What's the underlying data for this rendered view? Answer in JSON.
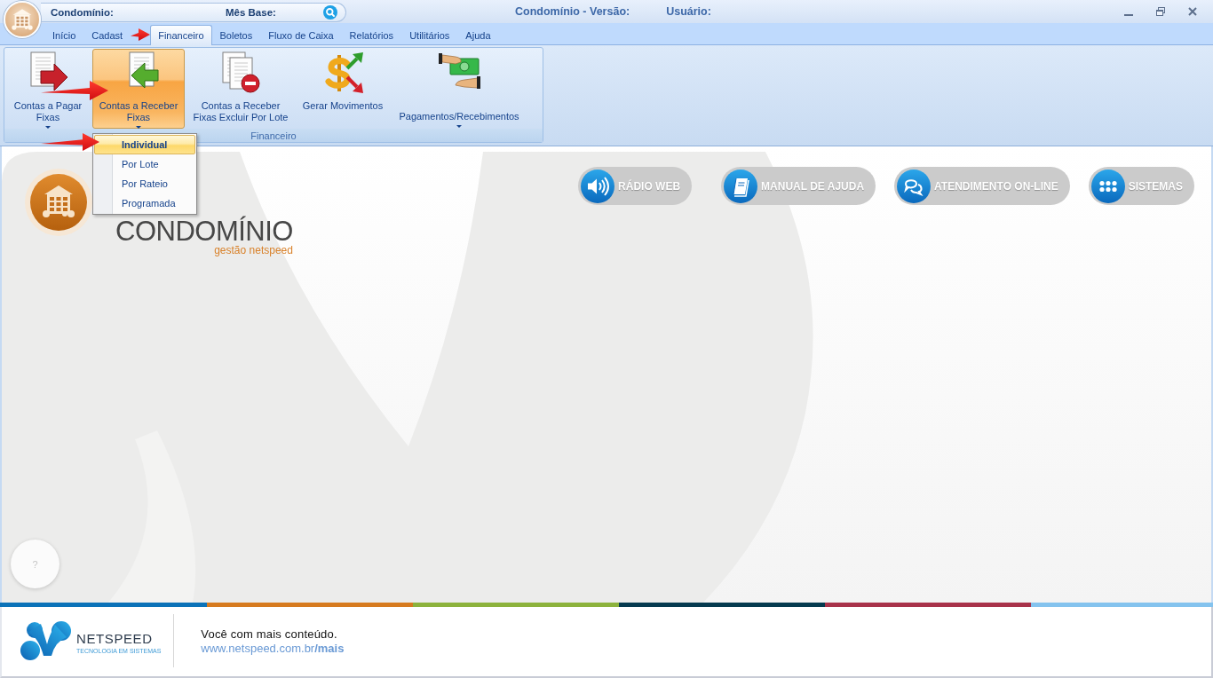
{
  "title_bar": {
    "quick_access": [
      {
        "label": "Condomínio:"
      },
      {
        "label": "Mês Base:"
      }
    ],
    "title": "Condomínio - Versão:",
    "user_label": "Usuário:"
  },
  "tabs": [
    {
      "label": "Início",
      "selected": false
    },
    {
      "label": "Cadast",
      "selected": false
    },
    {
      "label": "Financeiro",
      "selected": true
    },
    {
      "label": "Boletos",
      "selected": false
    },
    {
      "label": "Fluxo de Caixa",
      "selected": false
    },
    {
      "label": "Relatórios",
      "selected": false
    },
    {
      "label": "Utilitários",
      "selected": false
    },
    {
      "label": "Ajuda",
      "selected": false
    }
  ],
  "ribbon": {
    "group": {
      "title": "Financeiro",
      "buttons": [
        {
          "label_lines": [
            "Contas a Pagar",
            "Fixas"
          ],
          "dropdown": true,
          "active": false
        },
        {
          "label_lines": [
            "Contas a Receber",
            "Fixas"
          ],
          "dropdown": true,
          "active": true
        },
        {
          "label_lines": [
            "Contas a Receber",
            "Fixas Excluir Por Lote"
          ],
          "dropdown": false,
          "active": false
        },
        {
          "label_lines": [
            "Gerar Movimentos"
          ],
          "dropdown": false,
          "active": false
        },
        {
          "label_lines": [
            "Pagamentos/Recebimentos"
          ],
          "dropdown": true,
          "active": false
        }
      ]
    }
  },
  "dropdown_menu": {
    "items": [
      {
        "label": "Individual",
        "selected": true
      },
      {
        "label": "Por Lote",
        "selected": false
      },
      {
        "label": "Por Rateio",
        "selected": false
      },
      {
        "label": "Programada",
        "selected": false
      }
    ]
  },
  "brand": {
    "title": "CONDOMÍNIO",
    "subtitle": "gestão netspeed"
  },
  "quick_links": [
    {
      "label": "RÁDIO WEB"
    },
    {
      "label": "MANUAL DE AJUDA"
    },
    {
      "label": "ATENDIMENTO ON-LINE"
    },
    {
      "label": "SISTEMAS"
    }
  ],
  "help_button": {
    "label": "?"
  },
  "footer": {
    "company_name": "NETSPEED",
    "company_tagline": "TECNOLOGIA EM SISTEMAS",
    "slogan": "Você com mais conteúdo.",
    "link": "www.netspeed.com.br**/mais**"
  }
}
